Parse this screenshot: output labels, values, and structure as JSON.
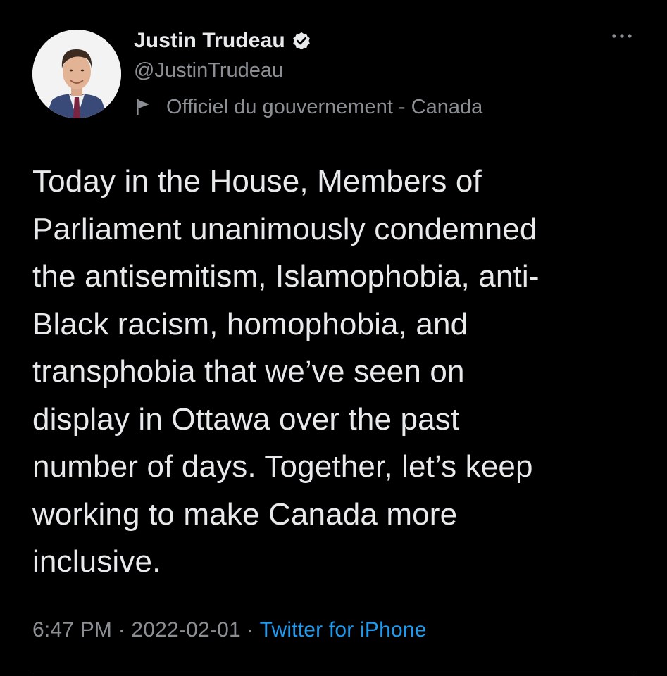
{
  "author": {
    "display_name": "Justin Trudeau",
    "handle": "@JustinTrudeau",
    "label": "Officiel du gouvernement - Canada",
    "avatar_icon": "profile-photo",
    "verified_icon": "verified-badge-icon",
    "flag_icon": "government-flag-icon"
  },
  "tweet": {
    "text": "Today in the House, Members of\nParliament unanimously condemned\nthe antisemitism, Islamophobia, anti-\nBlack racism, homophobia, and\ntransphobia that we’ve seen on\ndisplay in Ottawa over the past\nnumber of days. Together, let’s keep\nworking to make Canada more\ninclusive.",
    "time": "6:47 PM",
    "separator": " · ",
    "date": "2022-02-01",
    "source": "Twitter for iPhone"
  },
  "menu": {
    "more_icon": "more-options-icon"
  },
  "colors": {
    "background": "#000000",
    "text": "#e7e9ea",
    "secondary": "#8b8f94",
    "link": "#1d9bf0"
  }
}
